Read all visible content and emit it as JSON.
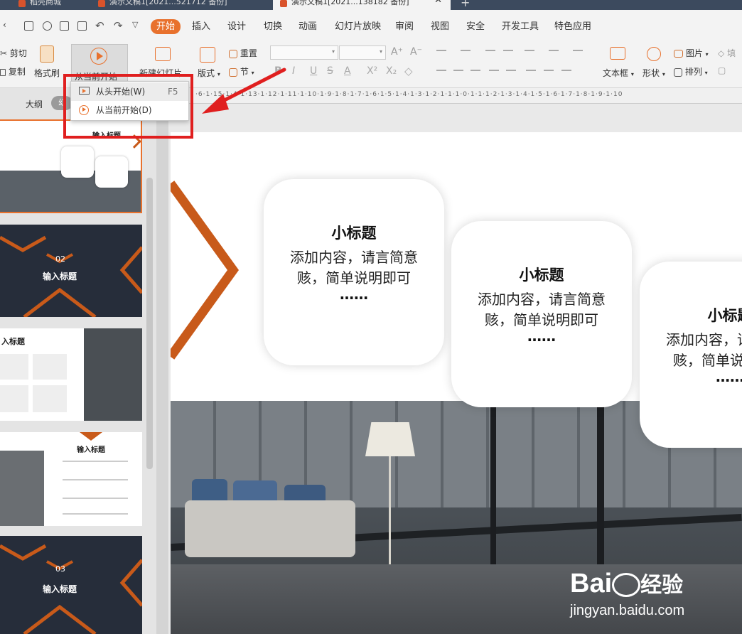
{
  "tabs": [
    {
      "label": "稻壳商城",
      "active": false
    },
    {
      "label": "演示文稿1[2021...521712 备份]",
      "active": false
    },
    {
      "label": "演示文稿1[2021...138182 备份]",
      "active": true
    },
    {
      "label": "+",
      "active": false
    }
  ],
  "menu": [
    "开始",
    "插入",
    "设计",
    "切换",
    "动画",
    "幻灯片放映",
    "审阅",
    "视图",
    "安全",
    "开发工具",
    "特色应用"
  ],
  "ribbon": {
    "cut": "剪切",
    "copy": "复制",
    "format_painter": "格式刷",
    "play_from_current": "从当前开始",
    "new_slide": "新建幻灯片",
    "layout": "版式",
    "reset": "重置",
    "section": "节",
    "textbox": "文本框",
    "shape": "形状",
    "picture": "图片",
    "arrange": "排列",
    "fill": "填"
  },
  "dropdown": [
    {
      "label": "从头开始(W)",
      "shortcut": "F5"
    },
    {
      "label": "从当前开始(D)",
      "shortcut": ""
    }
  ],
  "panel": {
    "outline_tab": "大纲",
    "slides_tab": "幻"
  },
  "thumbs": {
    "t1_title": "输入标题",
    "t2_number": "02",
    "t2_title": "输入标题",
    "t3_title": "入标题",
    "t4_title": "输入标题",
    "t5_number": "03",
    "t5_title": "输入标题"
  },
  "ruler_text": "·6·1·15·1·4·1·13·1·12·1·11·1·10·1·9·1·8·1·7·1·6·1·5·1·4·1·3·1·2·1·1·1·0·1·1·1·2·1·3·1·4·1·5·1·6·1·7·1·8·1·9·1·10",
  "slide": {
    "cards": [
      {
        "title": "小标题",
        "body": "添加内容，请言简意赅，简单说明即可",
        "dots": "……"
      },
      {
        "title": "小标题",
        "body": "添加内容，请言简意赅，简单说明即可",
        "dots": "……"
      },
      {
        "title": "小标题",
        "body": "添加内容，请言简意赅，简单说明即可",
        "dots": "……"
      }
    ]
  },
  "watermark": {
    "brand": "Bai",
    "brand2": "经验",
    "url": "jingyan.baidu.com"
  },
  "colors": {
    "accent": "#e8712d",
    "highlight": "#e01f1f",
    "dark_slide": "#262d3a"
  }
}
